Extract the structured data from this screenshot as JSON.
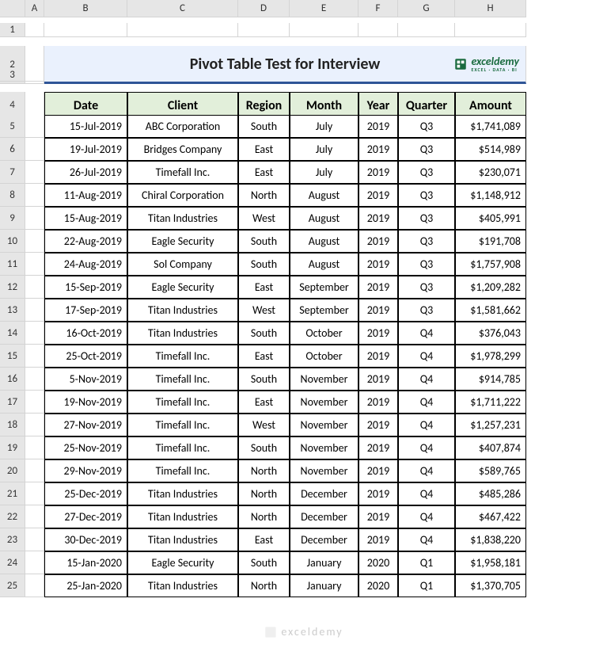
{
  "cols": [
    "A",
    "B",
    "C",
    "D",
    "E",
    "F",
    "G",
    "H"
  ],
  "rows": [
    "1",
    "2",
    "3",
    "4",
    "5",
    "6",
    "7",
    "8",
    "9",
    "10",
    "11",
    "12",
    "13",
    "14",
    "15",
    "16",
    "17",
    "18",
    "19",
    "20",
    "21",
    "22",
    "23",
    "24",
    "25"
  ],
  "title": "Pivot Table Test for Interview",
  "logo_text": "exceldemy",
  "logo_sub": "EXCEL · DATA · BI",
  "headers": [
    "Date",
    "Client",
    "Region",
    "Month",
    "Year",
    "Quarter",
    "Amount"
  ],
  "data": [
    [
      "15-Jul-2019",
      "ABC Corporation",
      "South",
      "July",
      "2019",
      "Q3",
      "$1,741,089"
    ],
    [
      "19-Jul-2019",
      "Bridges Company",
      "East",
      "July",
      "2019",
      "Q3",
      "$514,989"
    ],
    [
      "26-Jul-2019",
      "Timefall Inc.",
      "East",
      "July",
      "2019",
      "Q3",
      "$230,071"
    ],
    [
      "11-Aug-2019",
      "Chiral Corporation",
      "North",
      "August",
      "2019",
      "Q3",
      "$1,148,912"
    ],
    [
      "15-Aug-2019",
      "Titan Industries",
      "West",
      "August",
      "2019",
      "Q3",
      "$405,991"
    ],
    [
      "22-Aug-2019",
      "Eagle Security",
      "South",
      "August",
      "2019",
      "Q3",
      "$191,708"
    ],
    [
      "24-Aug-2019",
      "Sol Company",
      "South",
      "August",
      "2019",
      "Q3",
      "$1,757,908"
    ],
    [
      "15-Sep-2019",
      "Eagle Security",
      "East",
      "September",
      "2019",
      "Q3",
      "$1,209,282"
    ],
    [
      "17-Sep-2019",
      "Titan Industries",
      "West",
      "September",
      "2019",
      "Q3",
      "$1,581,662"
    ],
    [
      "16-Oct-2019",
      "Titan Industries",
      "South",
      "October",
      "2019",
      "Q4",
      "$376,043"
    ],
    [
      "25-Oct-2019",
      "Timefall Inc.",
      "East",
      "October",
      "2019",
      "Q4",
      "$1,978,299"
    ],
    [
      "5-Nov-2019",
      "Timefall Inc.",
      "South",
      "November",
      "2019",
      "Q4",
      "$914,785"
    ],
    [
      "19-Nov-2019",
      "Timefall Inc.",
      "East",
      "November",
      "2019",
      "Q4",
      "$1,711,222"
    ],
    [
      "27-Nov-2019",
      "Timefall Inc.",
      "West",
      "November",
      "2019",
      "Q4",
      "$1,257,231"
    ],
    [
      "25-Nov-2019",
      "Timefall Inc.",
      "South",
      "November",
      "2019",
      "Q4",
      "$407,874"
    ],
    [
      "29-Nov-2019",
      "Timefall Inc.",
      "North",
      "November",
      "2019",
      "Q4",
      "$589,765"
    ],
    [
      "25-Dec-2019",
      "Titan Industries",
      "North",
      "December",
      "2019",
      "Q4",
      "$485,286"
    ],
    [
      "27-Dec-2019",
      "Titan Industries",
      "North",
      "December",
      "2019",
      "Q4",
      "$467,422"
    ],
    [
      "30-Dec-2019",
      "Titan Industries",
      "East",
      "December",
      "2019",
      "Q4",
      "$1,838,220"
    ],
    [
      "15-Jan-2020",
      "Eagle Security",
      "South",
      "January",
      "2020",
      "Q1",
      "$1,958,181"
    ],
    [
      "25-Jan-2020",
      "Titan Industries",
      "North",
      "January",
      "2020",
      "Q1",
      "$1,370,705"
    ]
  ],
  "watermark": "exceldemy"
}
